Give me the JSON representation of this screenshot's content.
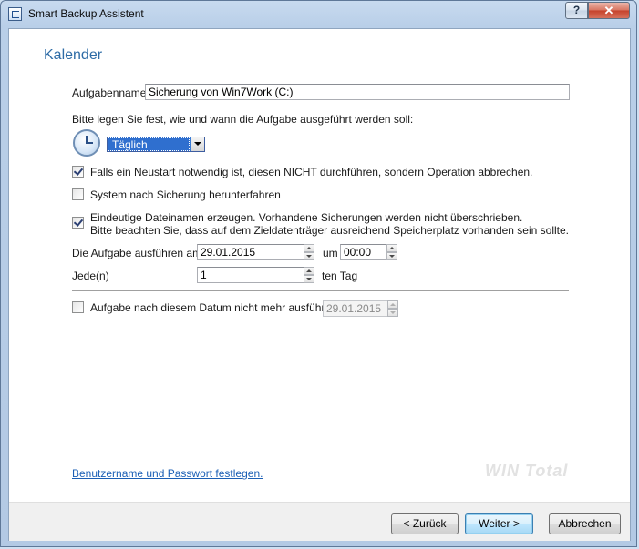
{
  "window": {
    "title": "Smart Backup Assistent",
    "help_label": "?",
    "close_label": "✕"
  },
  "page": {
    "title": "Kalender"
  },
  "form": {
    "task_name_label": "Aufgabenname:",
    "task_name_value": "Sicherung von Win7Work (C:)",
    "schedule_prompt": "Bitte legen Sie fest, wie und wann die Aufgabe ausgeführt werden soll:",
    "frequency_selected": "Täglich",
    "options": [
      {
        "label": "Falls ein Neustart notwendig ist, diesen NICHT durchführen, sondern Operation abbrechen.",
        "checked": true
      },
      {
        "label": "System nach Sicherung herunterfahren",
        "checked": false
      },
      {
        "label": "Eindeutige Dateinamen erzeugen. Vorhandene Sicherungen werden nicht überschrieben.",
        "label2": "Bitte beachten Sie, dass auf dem Zieldatenträger ausreichend Speicherplatz vorhanden sein sollte.",
        "checked": true
      }
    ],
    "run_on_label": "Die Aufgabe ausführen am:",
    "run_on_date": "29.01.2015",
    "at_label": "um",
    "at_time": "00:00",
    "every_label": "Jede(n)",
    "every_value": "1",
    "every_unit": "ten Tag",
    "end_date_label": "Aufgabe nach diesem Datum nicht mehr ausführen:",
    "end_date_checked": false,
    "end_date_value": "29.01.2015",
    "credentials_link": "Benutzername und Passwort festlegen."
  },
  "watermark": {
    "text_a": "WIN",
    "text_b": "Total"
  },
  "buttons": {
    "back": "< Zurück",
    "next": "Weiter >",
    "cancel": "Abbrechen"
  },
  "colors": {
    "title_blue": "#2e6ca6",
    "link_blue": "#1b5fb5",
    "selection_blue": "#2f6fcf"
  }
}
